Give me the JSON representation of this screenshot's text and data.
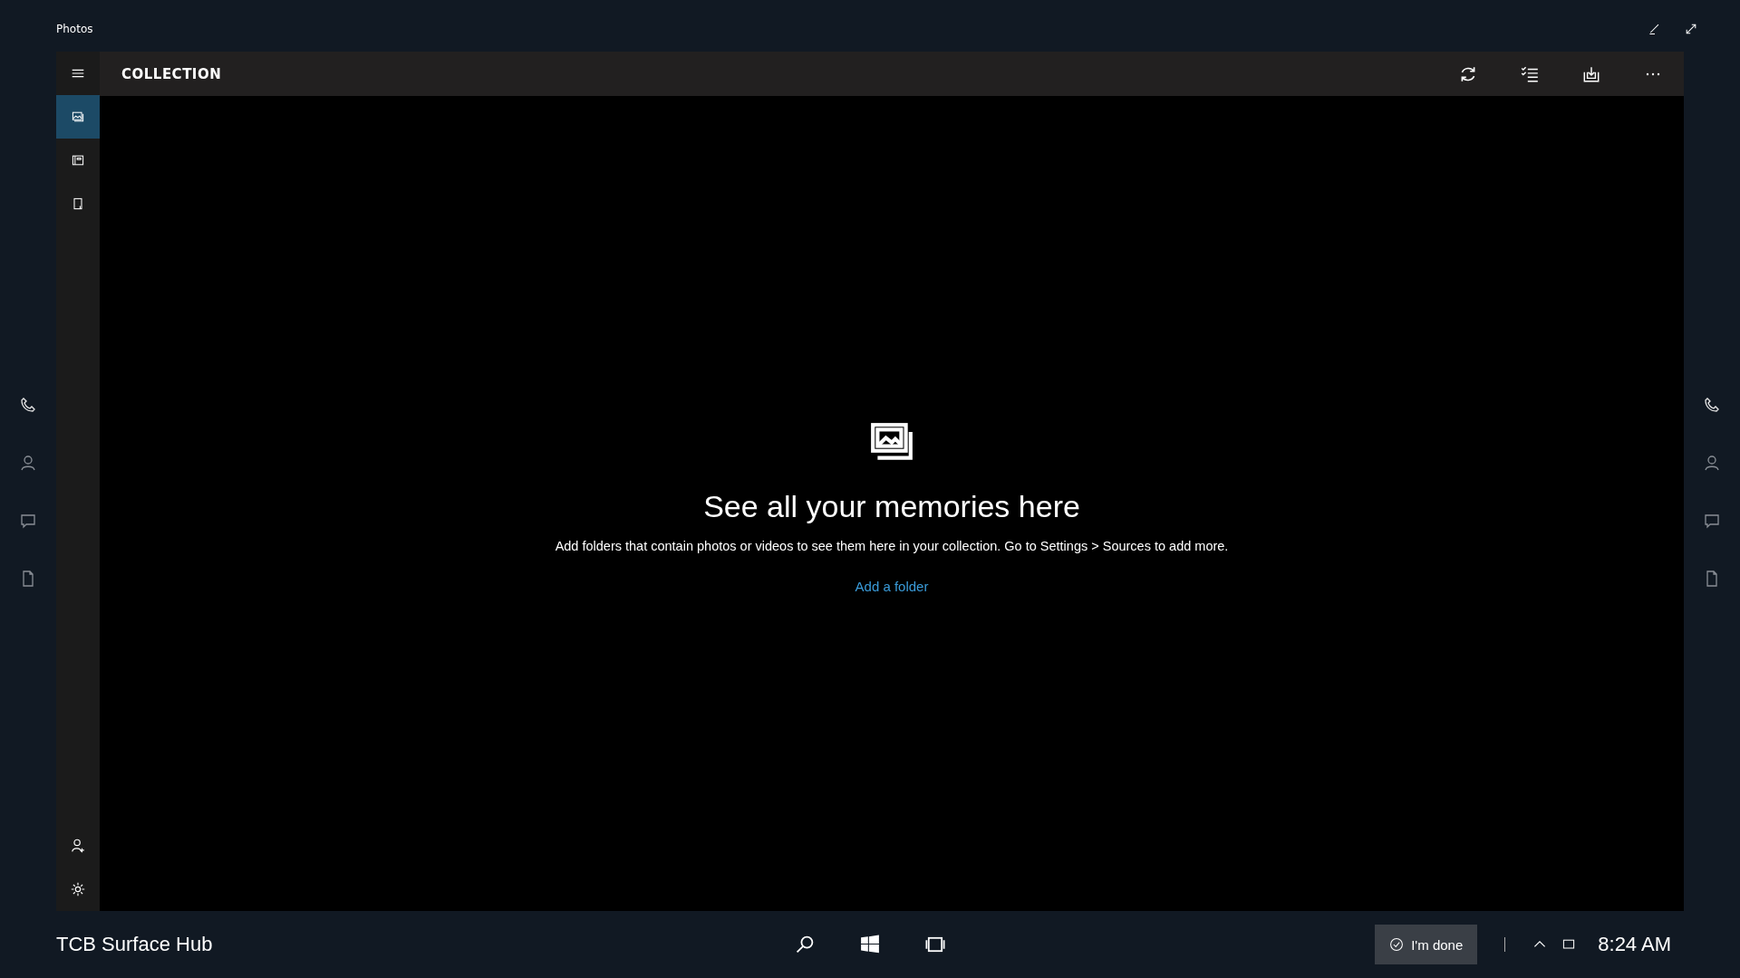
{
  "window": {
    "title": "Photos"
  },
  "app_bar": {
    "title": "COLLECTION"
  },
  "nav": {
    "items": [
      {
        "selected": true
      },
      {
        "selected": false
      },
      {
        "selected": false
      }
    ]
  },
  "empty_state": {
    "heading": "See all your memories here",
    "message": "Add folders that contain photos or videos to see them here in your collection. Go to Settings > Sources to add more.",
    "link": "Add a folder"
  },
  "taskbar": {
    "device_name": "TCB Surface Hub",
    "done_button": "I'm done",
    "time": "8:24 AM"
  }
}
